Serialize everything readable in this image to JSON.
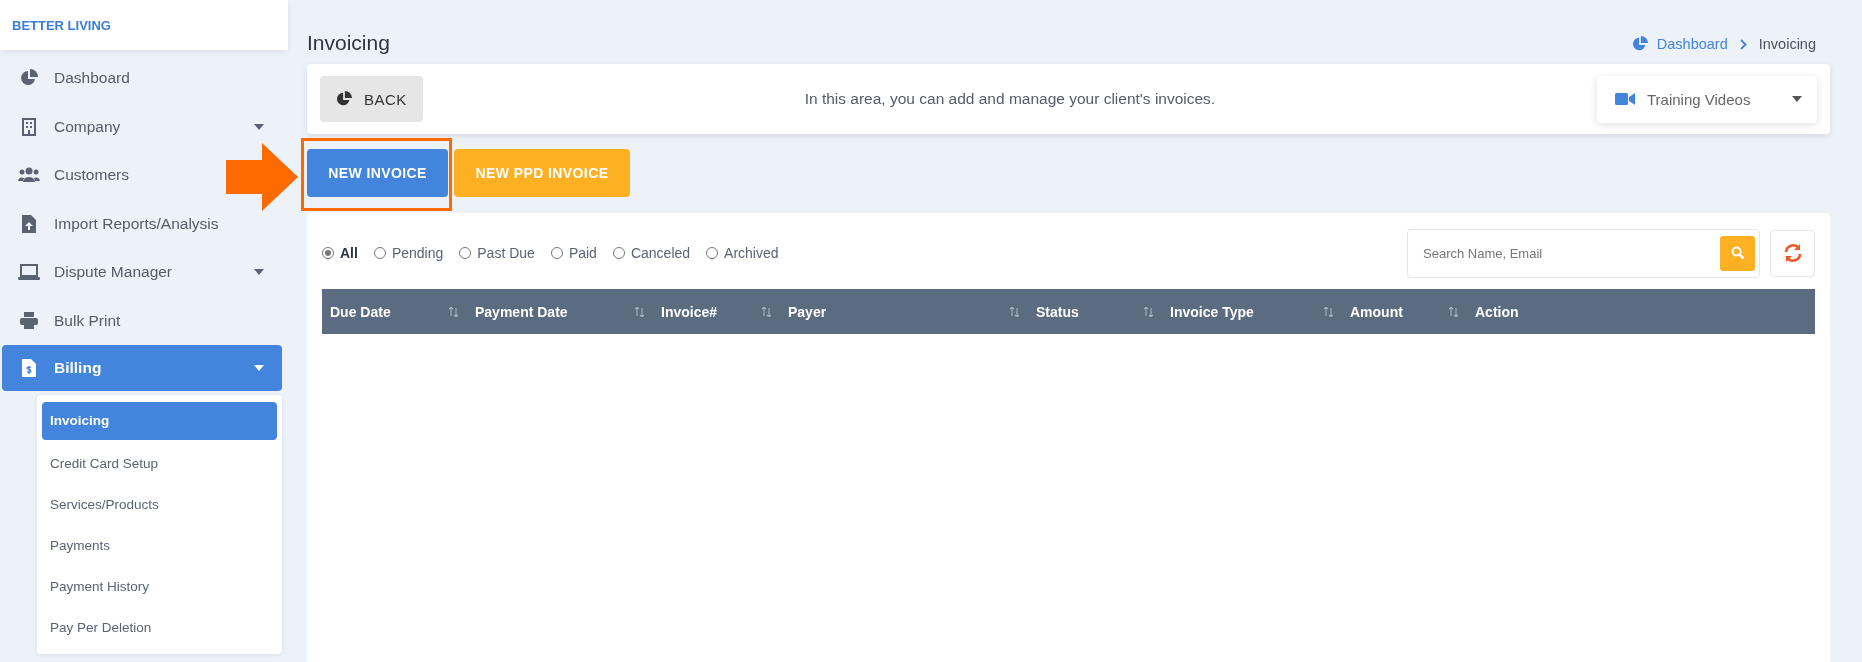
{
  "sidebar": {
    "brand": "BETTER LIVING",
    "items": [
      {
        "label": "Dashboard",
        "selected": false
      },
      {
        "label": "Company",
        "selected": false,
        "dropdown": true
      },
      {
        "label": "Customers",
        "selected": false
      },
      {
        "label": "Import Reports/Analysis",
        "selected": false
      },
      {
        "label": "Dispute Manager",
        "selected": false,
        "dropdown": true
      },
      {
        "label": "Bulk Print",
        "selected": false
      },
      {
        "label": "Billing",
        "selected": true,
        "expanded": true,
        "dropdown": true,
        "children": [
          {
            "label": "Invoicing",
            "selected": true
          },
          {
            "label": "Credit Card Setup",
            "selected": false
          },
          {
            "label": "Services/Products",
            "selected": false
          },
          {
            "label": "Payments",
            "selected": false
          },
          {
            "label": "Payment History",
            "selected": false
          },
          {
            "label": "Pay Per Deletion",
            "selected": false
          }
        ]
      }
    ]
  },
  "page": {
    "title": "Invoicing",
    "breadcrumb": [
      {
        "label": "Dashboard",
        "kind": "link"
      },
      {
        "label": "Invoicing",
        "kind": "current"
      }
    ],
    "back_button": "BACK",
    "description": "In this area, you can add and manage your client's invoices.",
    "training_dropdown": "Training Videos",
    "buttons": [
      {
        "label": "NEW INVOICE",
        "kind": "primary",
        "highlighted": true
      },
      {
        "label": "NEW PPD INVOICE",
        "kind": "warning",
        "highlighted": false
      }
    ]
  },
  "filters": [
    {
      "label": "All",
      "selected": true
    },
    {
      "label": "Pending",
      "selected": false
    },
    {
      "label": "Past Due",
      "selected": false
    },
    {
      "label": "Paid",
      "selected": false
    },
    {
      "label": "Canceled",
      "selected": false
    },
    {
      "label": "Archived",
      "selected": false
    }
  ],
  "search": {
    "placeholder": "Search Name, Email"
  },
  "table": {
    "columns": [
      "Due Date",
      "Payment Date",
      "Invoice#",
      "Payer",
      "Status",
      "Invoice Type",
      "Amount",
      "Action"
    ]
  }
}
